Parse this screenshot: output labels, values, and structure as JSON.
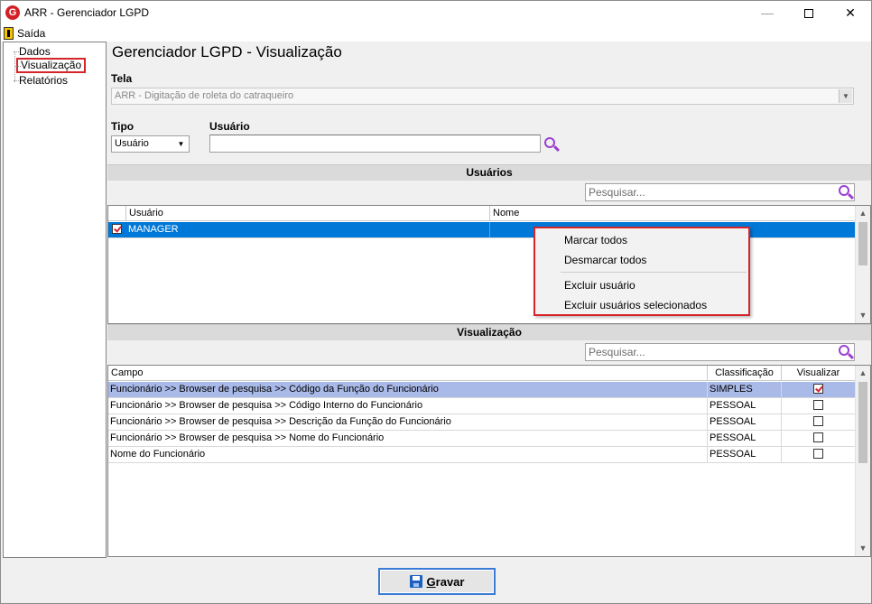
{
  "window": {
    "title": "ARR - Gerenciador LGPD",
    "logo_letter": "G",
    "minimize": "—",
    "close": "✕"
  },
  "menu": {
    "exit_label": "Saída"
  },
  "tree": {
    "items": [
      {
        "label": "Dados",
        "selected": false
      },
      {
        "label": "Visualização",
        "selected": true
      },
      {
        "label": "Relatórios",
        "selected": false
      }
    ]
  },
  "main": {
    "title": "Gerenciador LGPD - Visualização",
    "tela_label": "Tela",
    "tela_value": "ARR - Digitação de roleta do catraqueiro",
    "tipo_label": "Tipo",
    "tipo_value": "Usuário",
    "usuario_label": "Usuário",
    "usuario_value": ""
  },
  "users_section": {
    "header": "Usuários",
    "search_placeholder": "Pesquisar...",
    "columns": [
      "Usuário",
      "Nome"
    ],
    "rows": [
      {
        "checked": true,
        "usuario": "MANAGER",
        "nome": "",
        "selected": true
      }
    ]
  },
  "context_menu": {
    "items": [
      "Marcar todos",
      "Desmarcar todos",
      "Excluir usuário",
      "Excluir usuários selecionados"
    ]
  },
  "view_section": {
    "header": "Visualização",
    "search_placeholder": "Pesquisar...",
    "columns": [
      "Campo",
      "Classificação",
      "Visualizar"
    ],
    "rows": [
      {
        "campo": "Funcionário >> Browser de pesquisa >> Código da Função do Funcionário",
        "classificacao": "SIMPLES",
        "visualizar": true,
        "selected": true
      },
      {
        "campo": "Funcionário >> Browser de pesquisa >> Código Interno do Funcionário",
        "classificacao": "PESSOAL",
        "visualizar": false,
        "selected": false
      },
      {
        "campo": "Funcionário >> Browser de pesquisa >> Descrição da Função do Funcionário",
        "classificacao": "PESSOAL",
        "visualizar": false,
        "selected": false
      },
      {
        "campo": "Funcionário >> Browser de pesquisa >> Nome do Funcionário",
        "classificacao": "PESSOAL",
        "visualizar": false,
        "selected": false
      },
      {
        "campo": "Nome do Funcionário",
        "classificacao": "PESSOAL",
        "visualizar": false,
        "selected": false
      }
    ]
  },
  "footer": {
    "save_accel": "G",
    "save_rest": "ravar"
  },
  "colors": {
    "selection_blue": "#0078d7",
    "selection_light": "#a9b9e8",
    "highlight_red": "#d6242b",
    "search_purple": "#9b3fd1"
  }
}
